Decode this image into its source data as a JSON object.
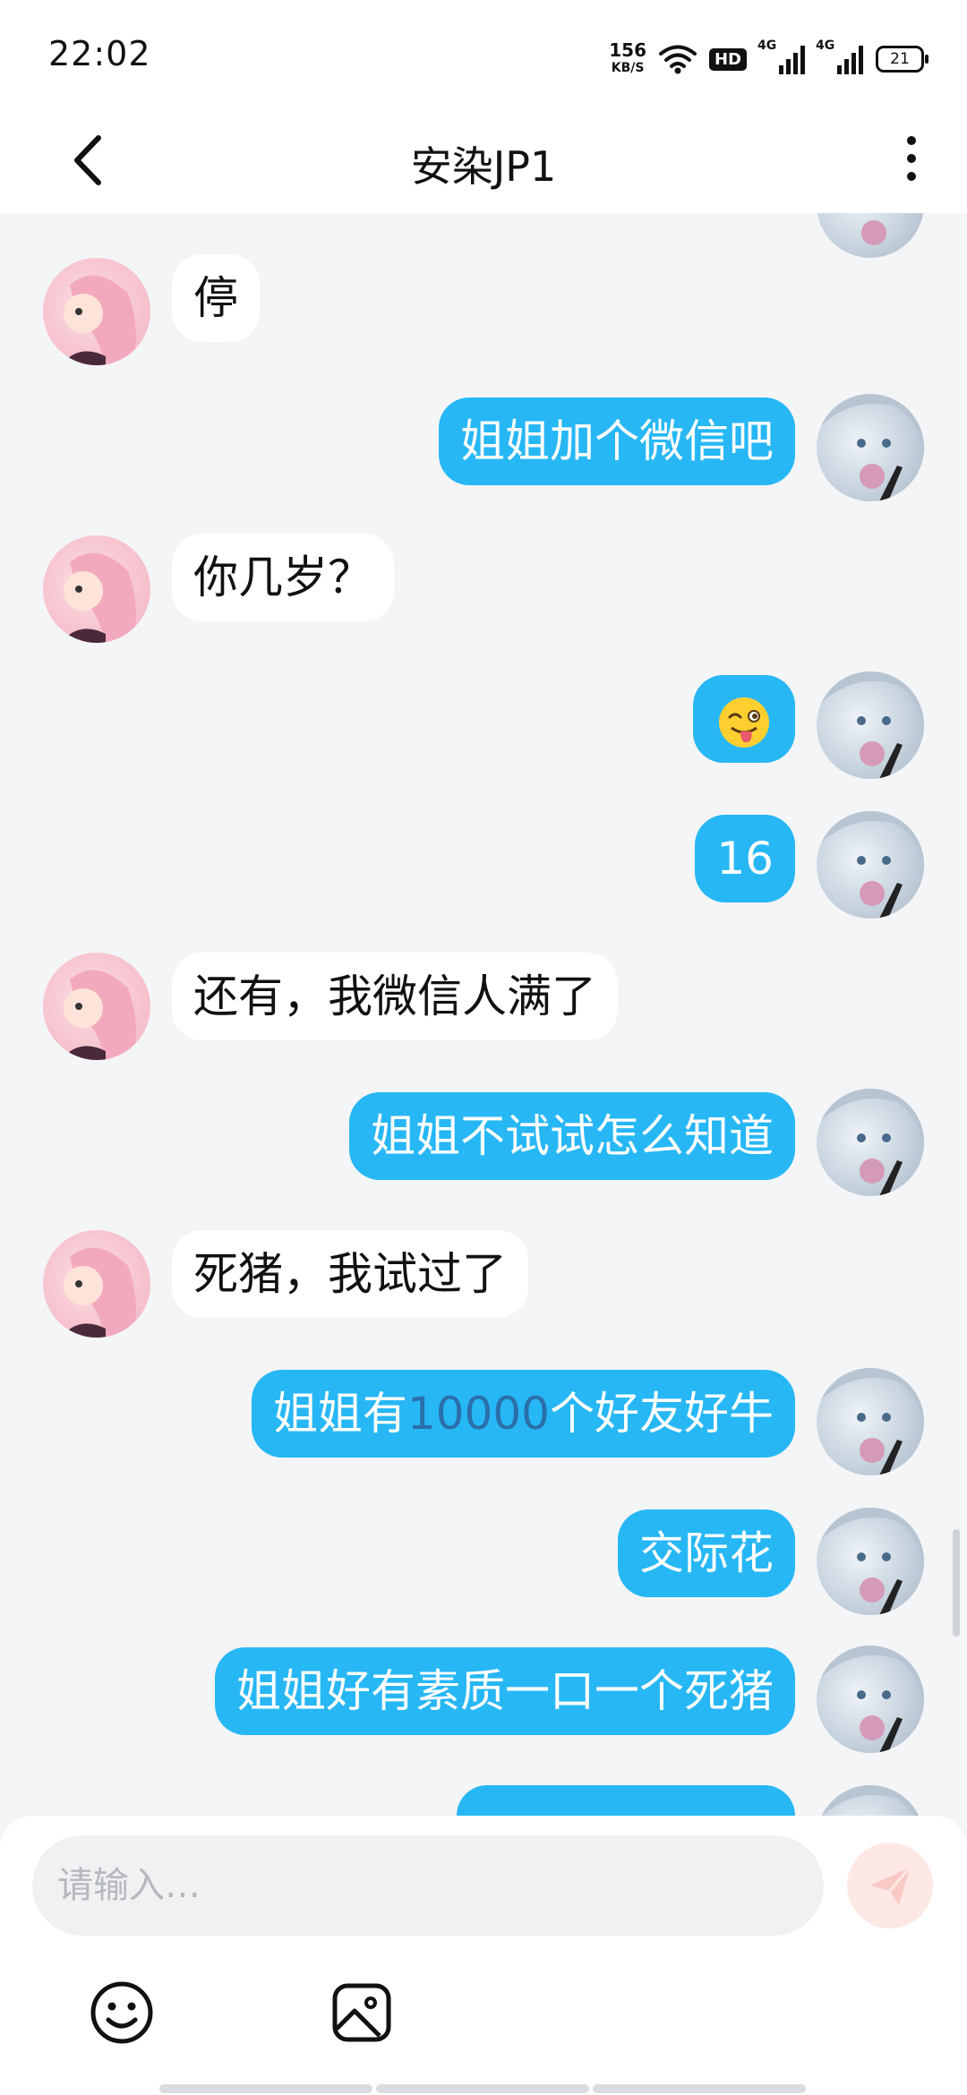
{
  "status_bar": {
    "time": "22:02",
    "net_speed_value": "156",
    "net_speed_unit": "KB/S",
    "hd_label": "HD",
    "signal_1_label": "4G",
    "signal_2_label": "4G",
    "battery": "21"
  },
  "header": {
    "title": "安染JP1",
    "back_icon": "chevron-left-icon",
    "menu_icon": "more-vertical-icon"
  },
  "messages": [
    {
      "side": "in",
      "text": "停"
    },
    {
      "side": "out",
      "text": "姐姐加个微信吧"
    },
    {
      "side": "in",
      "text": "你几岁？"
    },
    {
      "side": "out",
      "text": "😜"
    },
    {
      "side": "out",
      "text": "16"
    },
    {
      "side": "in",
      "text": "还有，我微信人满了"
    },
    {
      "side": "out",
      "text": "姐姐不试试怎么知道"
    },
    {
      "side": "in",
      "text": "死猪，我试过了"
    },
    {
      "side": "out",
      "text_before": "姐姐有",
      "text_highlight": "10000",
      "text_after": "个好友好牛"
    },
    {
      "side": "out",
      "text": "交际花"
    },
    {
      "side": "out",
      "text": "姐姐好有素质一口一个死猪"
    }
  ],
  "composer": {
    "placeholder": "请输入…",
    "send_icon": "send-icon",
    "tools": [
      "emoji-icon",
      "image-icon"
    ]
  },
  "colors": {
    "outgoing_bubble": "#27b7f5",
    "incoming_bubble": "#ffffff",
    "background": "#f4f5f7",
    "number_highlight": "#2a6fa9"
  }
}
